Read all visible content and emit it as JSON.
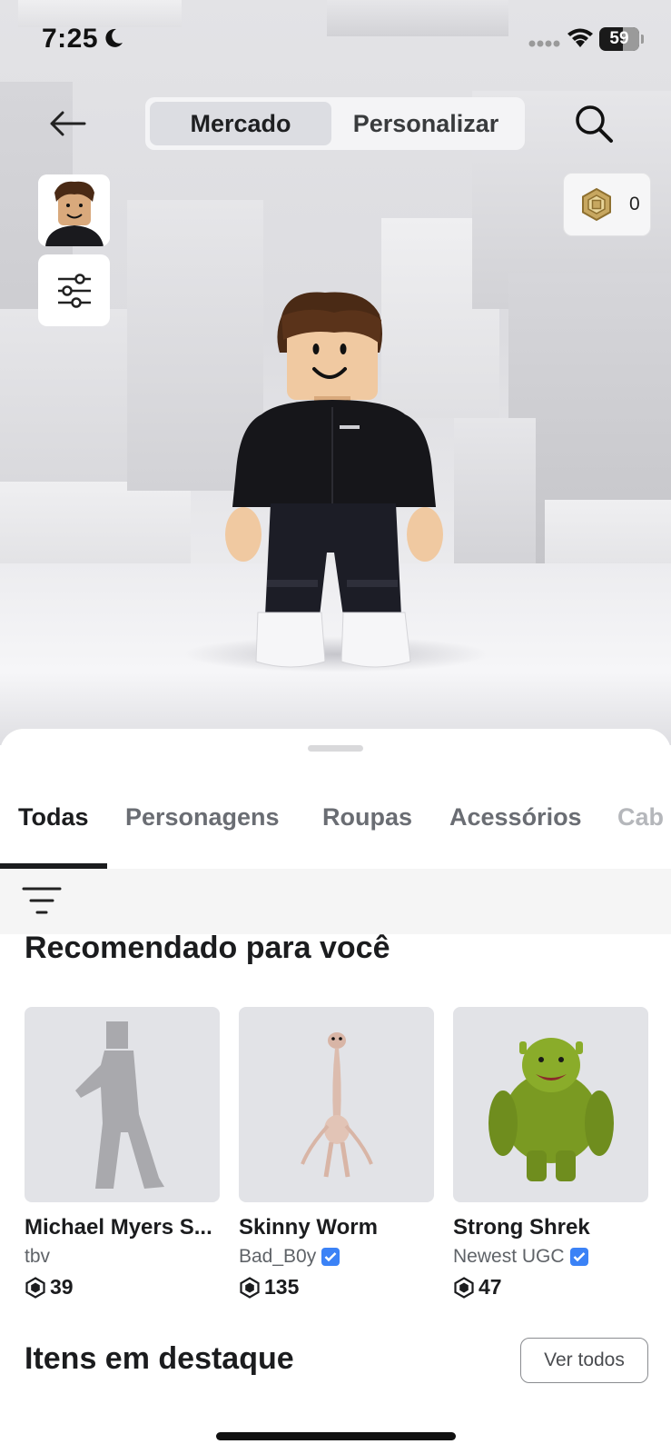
{
  "status_bar": {
    "time": "7:25",
    "battery": "59",
    "icons": [
      "moon-icon",
      "signal-dots-icon",
      "wifi-icon",
      "battery-icon"
    ]
  },
  "top_nav": {
    "back_icon": "arrow-left-icon",
    "segments": [
      {
        "label": "Mercado",
        "active": true
      },
      {
        "label": "Personalizar",
        "active": false
      }
    ],
    "search_icon": "search-icon",
    "filters_icon": "sliders-icon",
    "robux_balance": "0"
  },
  "tabs": [
    {
      "label": "Todas",
      "active": true
    },
    {
      "label": "Personagens",
      "active": false
    },
    {
      "label": "Roupas",
      "active": false
    },
    {
      "label": "Acessórios",
      "active": false
    },
    {
      "label": "Cab",
      "active": false
    }
  ],
  "recommended": {
    "title": "Recomendado para você",
    "items": [
      {
        "name": "Michael Myers S...",
        "creator": "tbv",
        "verified": false,
        "price": "39"
      },
      {
        "name": "Skinny Worm",
        "creator": "Bad_B0y",
        "verified": true,
        "price": "135"
      },
      {
        "name": "Strong Shrek",
        "creator": "Newest UGC",
        "verified": true,
        "price": "47"
      }
    ]
  },
  "featured": {
    "title": "Itens em destaque",
    "see_all_label": "Ver todos"
  },
  "colors": {
    "accent": "#1b1c1e",
    "verified": "#3b82f6",
    "tile_bg": "#e2e3e7"
  }
}
